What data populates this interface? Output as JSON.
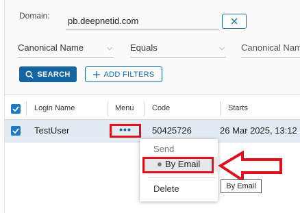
{
  "filters": {
    "domain_label": "Domain:",
    "domain_value": "pb.deepnetid.com",
    "clear_icon": "close-icon",
    "field_select": "Canonical Name",
    "operator_select": "Equals",
    "value_select": "Canonical Nam",
    "search_label": "SEARCH",
    "add_filters_label": "ADD FILTERS"
  },
  "table": {
    "columns": [
      "Login Name",
      "Menu",
      "Code",
      "Starts"
    ],
    "rows": [
      {
        "login_name": "TestUser",
        "menu": "•••",
        "code": "50425726",
        "starts": "26 Mar 2025, 13:12"
      }
    ]
  },
  "context_menu": {
    "section": "Send",
    "item_email": "By Email",
    "item_delete": "Delete"
  },
  "tooltip": "By Email",
  "colors": {
    "primary": "#1565a3",
    "highlight": "#e2101c",
    "row_selected": "#e2ebf1"
  }
}
